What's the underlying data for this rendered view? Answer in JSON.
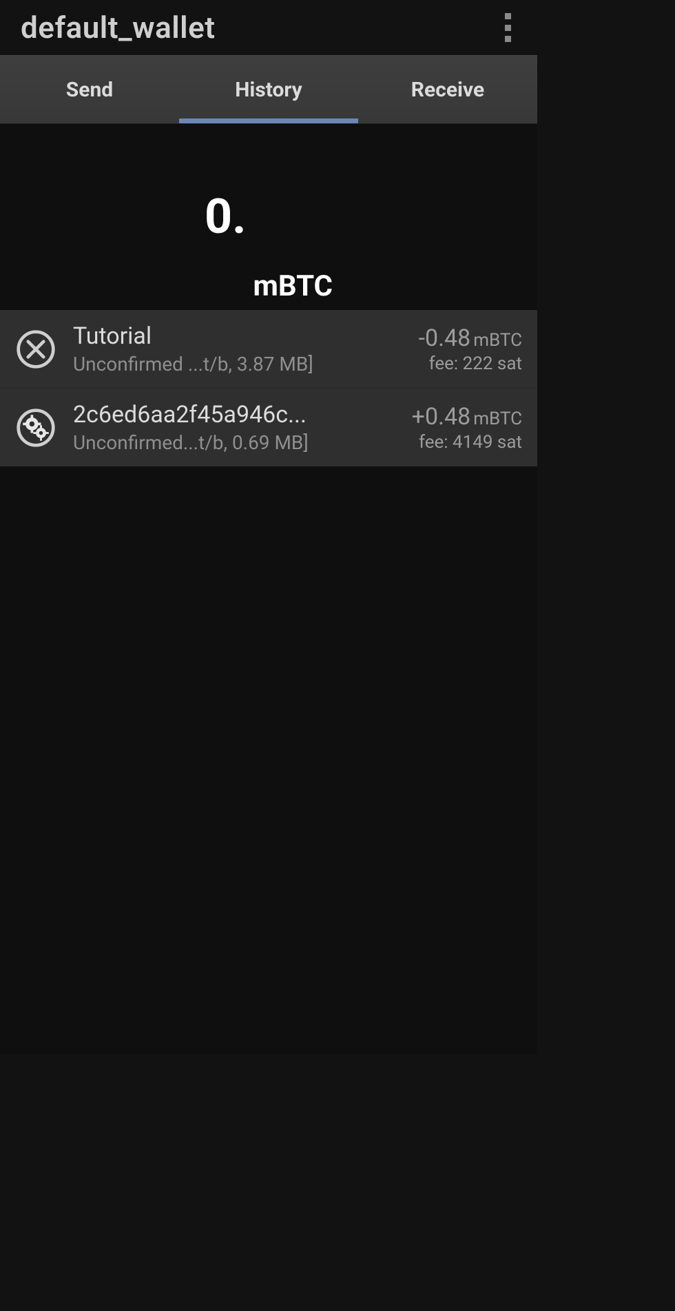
{
  "header": {
    "title": "default_wallet"
  },
  "tabs": {
    "send": "Send",
    "history": "History",
    "receive": "Receive",
    "active": "history"
  },
  "balance": {
    "value": "0.",
    "unit": "mBTC"
  },
  "transactions": [
    {
      "icon": "circle-x",
      "title": "Tutorial",
      "subtitle": "Unconfirmed ...t/b, 3.87 MB]",
      "amount": "-0.48",
      "amount_unit": "mBTC",
      "fee": "fee: 222 sat"
    },
    {
      "icon": "gears",
      "title": "2c6ed6aa2f45a946c...",
      "subtitle": "Unconfirmed...t/b, 0.69 MB]",
      "amount": "+0.48",
      "amount_unit": "mBTC",
      "fee": "fee: 4149 sat"
    }
  ]
}
